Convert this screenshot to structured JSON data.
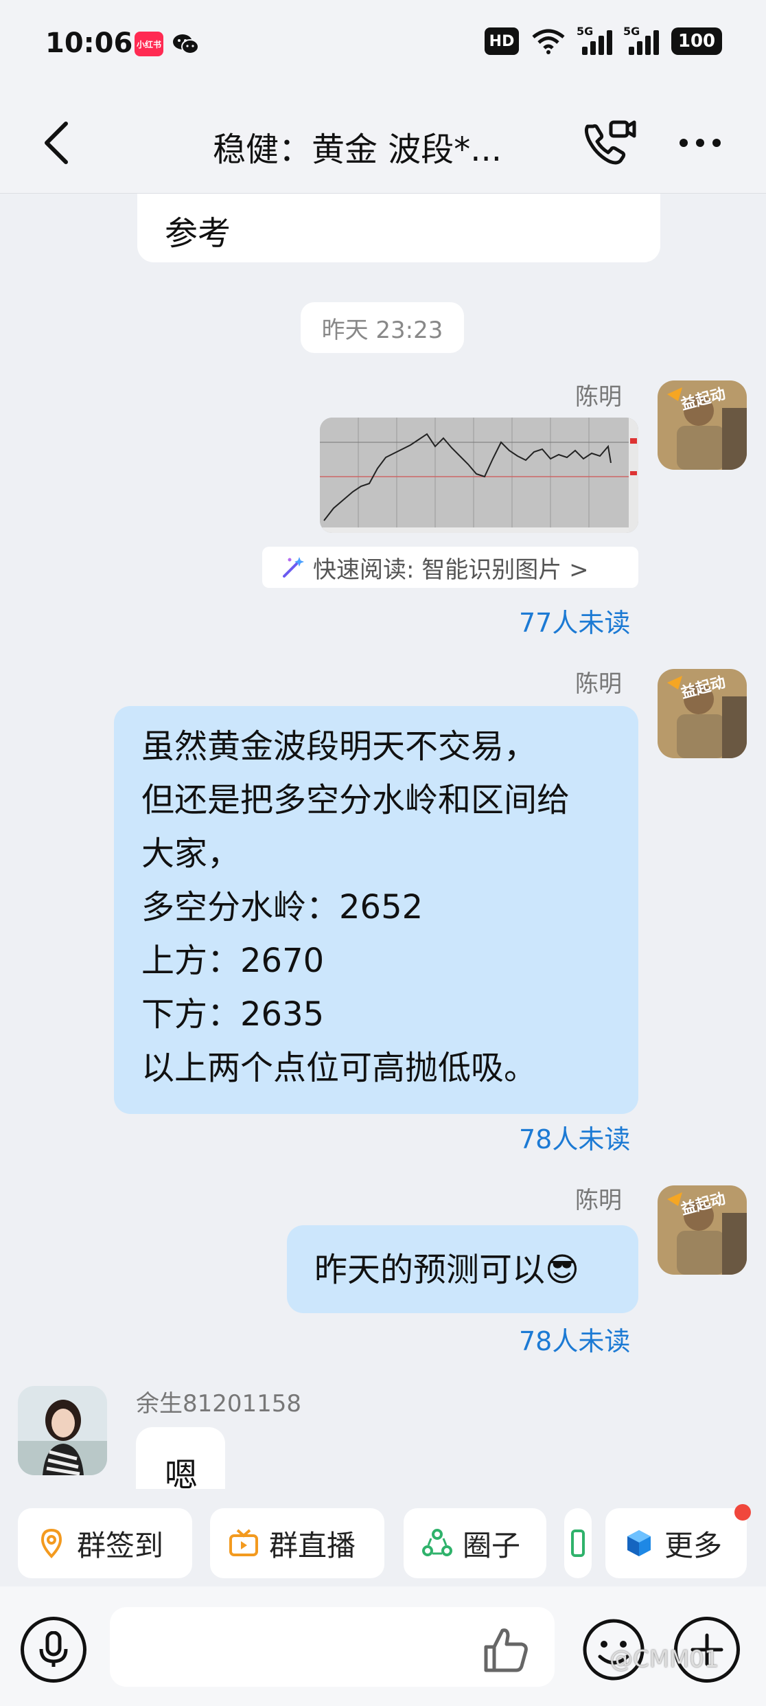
{
  "status_bar": {
    "time": "10:06",
    "app_badge": "小红书",
    "hd": "HD",
    "network_1": "5G",
    "network_2": "5G",
    "battery": "100"
  },
  "header": {
    "title": "稳健：黄金 波段*..."
  },
  "messages": {
    "top_bubble_text": "参考",
    "timestamp": "昨天 23:23",
    "sender_1": "陈明",
    "quick_read": "快速阅读: 智能识别图片 >",
    "unread_1": "77人未读",
    "sender_2": "陈明",
    "long_message_lines": [
      "虽然黄金波段明天不交易，",
      "但还是把多空分水岭和区间给",
      "大家，",
      "多空分水岭：2652",
      "上方：2670",
      "下方：2635",
      "以上两个点位可高抛低吸。"
    ],
    "unread_2": "78人未读",
    "sender_3": "陈明",
    "short_message": "昨天的预测可以😎",
    "unread_3": "78人未读",
    "other_sender": "余生81201158",
    "other_message": "嗯",
    "avatar_sticker_text": "益起动"
  },
  "quick_actions": [
    {
      "label": "群签到",
      "icon": "location-pin-icon"
    },
    {
      "label": "群直播",
      "icon": "tv-icon"
    },
    {
      "label": "圈子",
      "icon": "circle-group-icon"
    },
    {
      "label": "更多",
      "icon": "cube-icon"
    }
  ],
  "input": {
    "placeholder": ""
  },
  "watermark": "@CMM01",
  "colors": {
    "bubble_blue": "#cce6fc",
    "unread_blue": "#1c7ad4",
    "badge_red": "#ff2a52",
    "dot_red": "#f0473c"
  }
}
